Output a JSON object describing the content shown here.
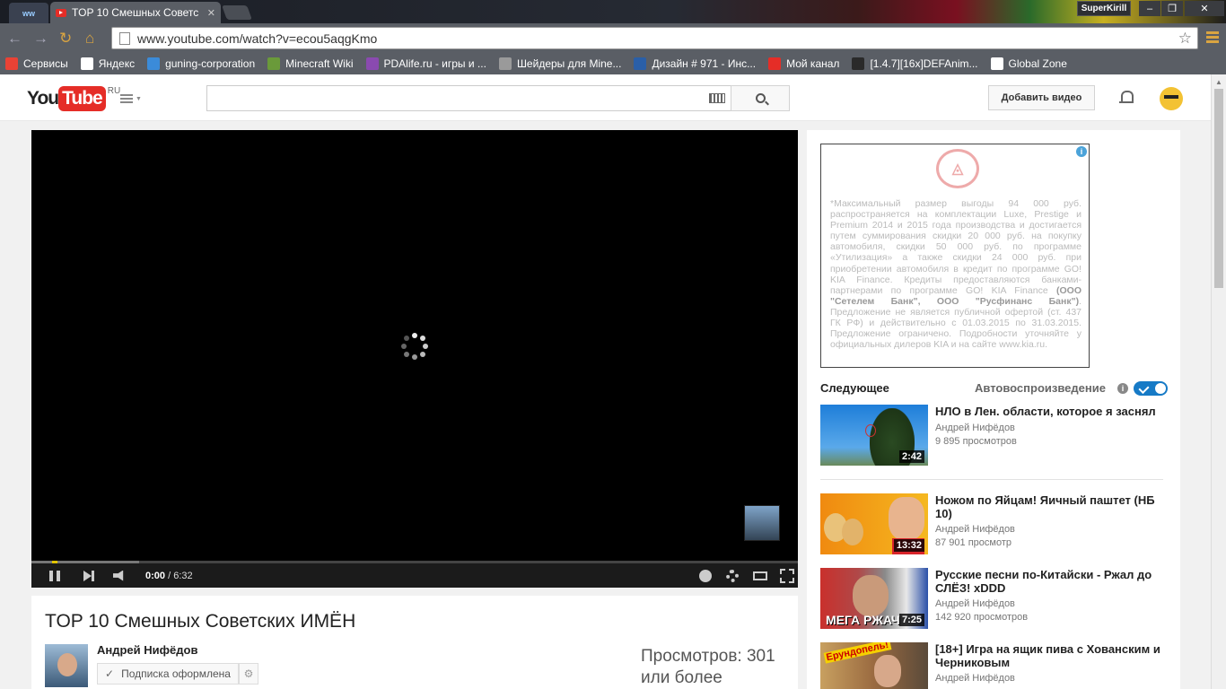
{
  "browser": {
    "tab_title": "TOP 10 Смешных Советс",
    "tab_close": "✕",
    "user_name": "SuperKirill",
    "url": "www.youtube.com/watch?v=ecou5aqgKmo",
    "bookmarks": [
      {
        "label": "Сервисы",
        "color": "#e94235"
      },
      {
        "label": "Яндекс",
        "color": "#ffffff"
      },
      {
        "label": "guning-corporation",
        "color": "#3b8bd9"
      },
      {
        "label": "Minecraft Wiki",
        "color": "#6a9a3a"
      },
      {
        "label": "PDAlife.ru - игры и ...",
        "color": "#8a4ab0"
      },
      {
        "label": "Шейдеры для Mine...",
        "color": "#9a9a9a"
      },
      {
        "label": "Дизайн # 971 - Инс...",
        "color": "#2a5fa8"
      },
      {
        "label": "Мой канал",
        "color": "#e52d27"
      },
      {
        "label": "[1.4.7][16x]DEFAnim...",
        "color": "#2a2a2a"
      },
      {
        "label": "Global Zone",
        "color": "#ffffff"
      }
    ]
  },
  "masthead": {
    "logo_you": "You",
    "logo_tube": "Tube",
    "logo_region": "RU",
    "upload_label": "Добавить видео"
  },
  "player": {
    "time_current": "0:00",
    "time_separator": " / ",
    "time_total": "6:32",
    "progress_played": 0.003
  },
  "video": {
    "title": "TOP 10 Смешных Советских ИМЁН",
    "owner": "Андрей Нифёдов",
    "subscribe_label": "Подписка оформлена",
    "views_label": "Просмотров: 301 или более"
  },
  "ad": {
    "text_1": "*Максимальный размер выгоды 94 000 руб. распространяется на комплектации Luxe, Prestige и Premium 2014 и 2015 года производства и достигается путем суммирования скидки 20 000 руб. на покупку автомобиля, скидки 50 000 руб. по программе «Утилизация» а также скидки 24 000 руб. при приобретении автомобиля в кредит по программе GO! KIA Finance. Кредиты предоставляются банками-партнерами по программе GO! KIA Finance ",
    "text_bold": "(ООО \"Сетелем Банк\", ООО \"Русфинанс Банк\")",
    "text_2": ". Предложение не является публичной офертой (ст. 437 ГК РФ) и действительно с 01.03.2015 по 31.03.2015. Предложение ограничено. Подробности уточняйте у официальных дилеров KIA и на сайте www.kia.ru.",
    "info_glyph": "i"
  },
  "sidebar": {
    "up_next": "Следующее",
    "autoplay": "Автовоспроизведение",
    "recs": [
      {
        "title": "НЛО в Лен. области, которое я заснял",
        "channel": "Андрей Нифёдов",
        "views": "9 895 просмотров",
        "duration": "2:42"
      },
      {
        "title": "Ножом по Яйцам! Яичный паштет (НБ 10)",
        "channel": "Андрей Нифёдов",
        "views": "87 901 просмотр",
        "duration": "13:32"
      },
      {
        "title": "Русские песни по-Китайски - Ржал до СЛЁЗ! xDDD",
        "channel": "Андрей Нифёдов",
        "views": "142 920 просмотров",
        "duration": "7:25",
        "overlay": "МЕГА РЖАЧ"
      },
      {
        "title": "[18+] Игра на ящик пива с Хованским и Черниковым",
        "channel": "Андрей Нифёдов",
        "views": "",
        "duration": "",
        "overlay": "Ерундопель!"
      }
    ]
  }
}
